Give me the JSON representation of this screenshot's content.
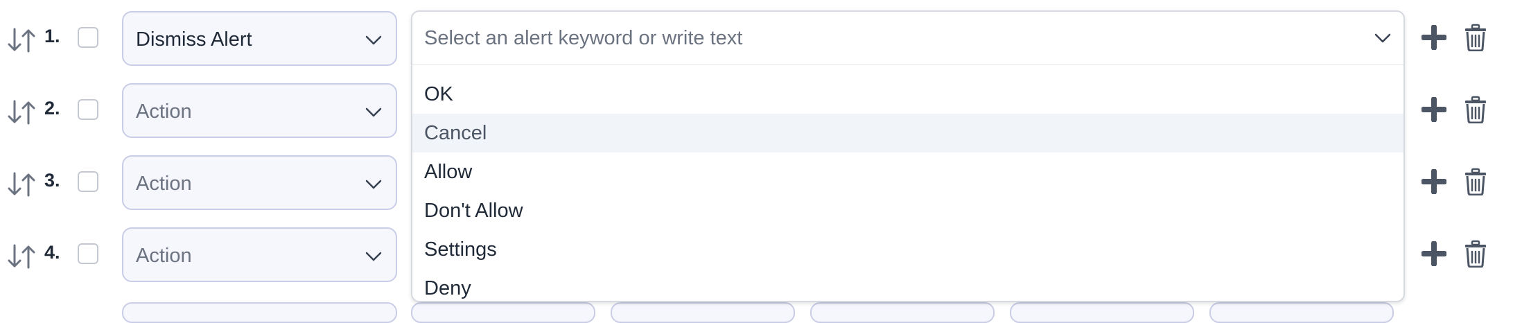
{
  "steps": [
    {
      "number": "1.",
      "action": "Dismiss Alert",
      "action_set": true
    },
    {
      "number": "2.",
      "action": "Action",
      "action_set": false
    },
    {
      "number": "3.",
      "action": "Action",
      "action_set": false
    },
    {
      "number": "4.",
      "action": "Action",
      "action_set": false
    }
  ],
  "alert_combobox": {
    "placeholder": "Select an alert keyword or write text",
    "value": "",
    "options": [
      "OK",
      "Cancel",
      "Allow",
      "Don't Allow",
      "Settings",
      "Deny"
    ],
    "highlighted_option": "Cancel"
  },
  "icons": {
    "reorder": "sort-arrows-icon",
    "add": "plus-icon",
    "delete": "trash-icon",
    "dropdown": "chevron-down-icon"
  },
  "colors": {
    "select_background": "#f6f6fd",
    "select_border": "#c9cde6",
    "highlight": "#f1f4f8",
    "icon": "#4b5563"
  }
}
